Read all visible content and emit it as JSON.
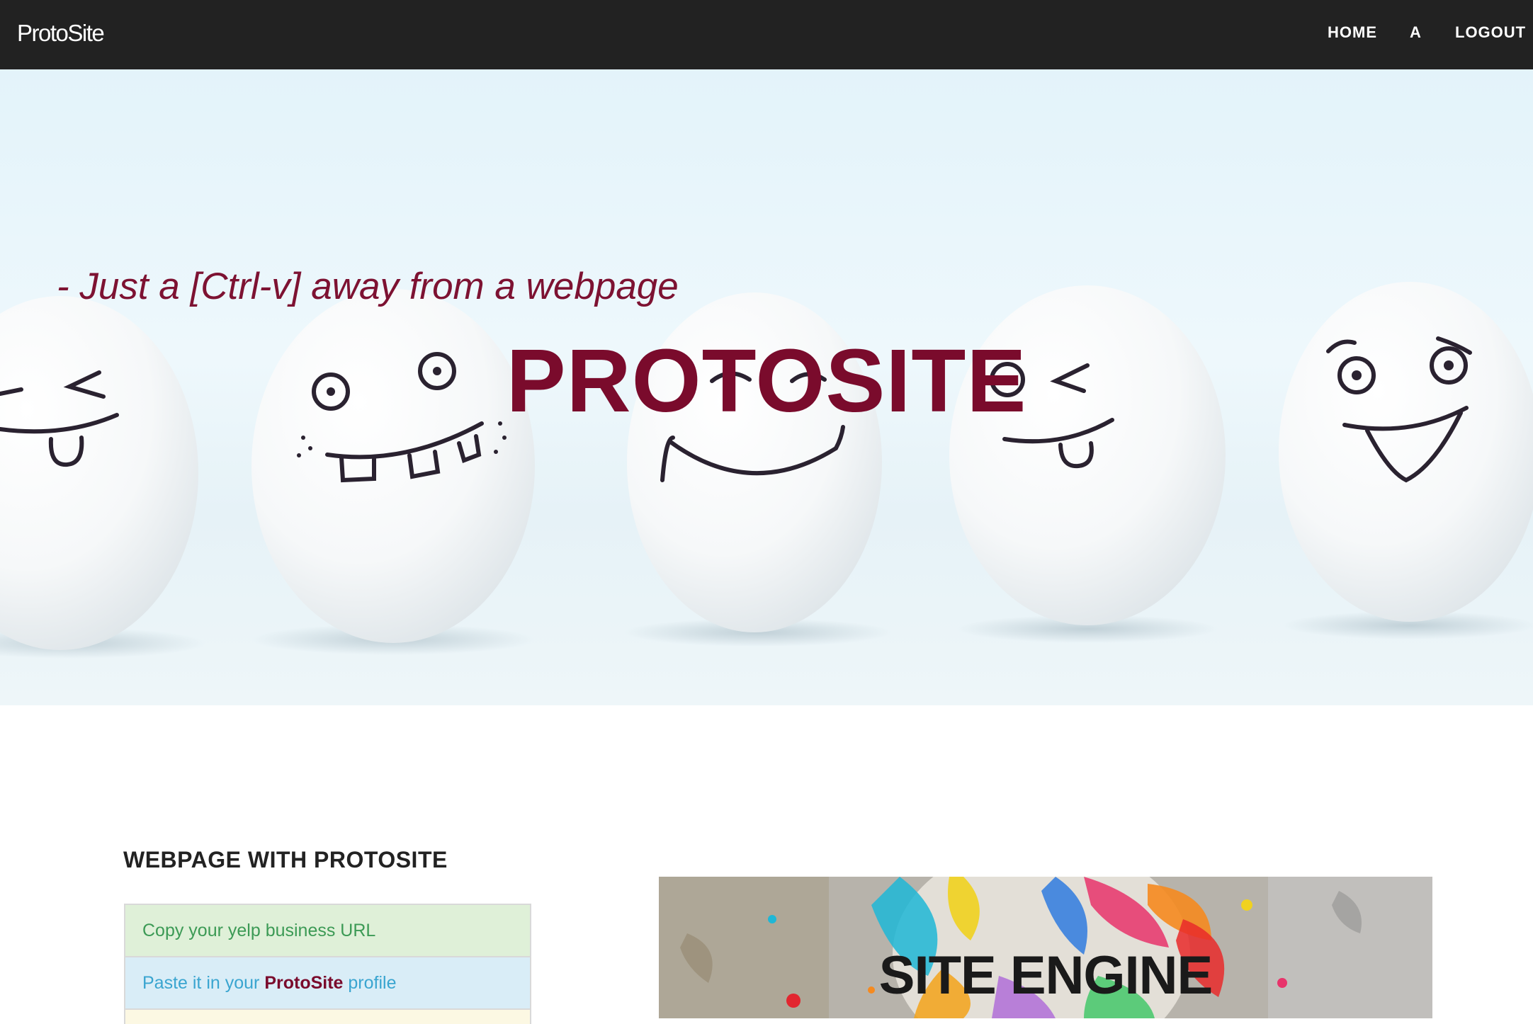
{
  "navbar": {
    "brand": "ProtoSite",
    "links": [
      "HOME",
      "A",
      "LOGOUT"
    ]
  },
  "hero": {
    "tagline": "- Just a [Ctrl-v] away from a webpage",
    "title": "PROTOSITE",
    "image_icon": "smiling-eggs-illustration"
  },
  "main": {
    "heading": "WEBPAGE WITH PROTOSITE",
    "steps": {
      "step1": "Copy your yelp business URL",
      "step2_before": "Paste it in your ",
      "step2_strong": "ProtoSite",
      "step2_after": " profile",
      "step3": ""
    },
    "engine_image": {
      "title": "SITE ENGINE",
      "icon": "paint-splash-illustration"
    }
  },
  "colors": {
    "navbar_bg": "#222222",
    "brand_maroon": "#7a0b2c",
    "success_bg": "#dff0d8",
    "success_text": "#3c9a55",
    "info_bg": "#d9edf7",
    "info_text": "#3aa5d0",
    "warning_bg": "#fcf8e3"
  }
}
